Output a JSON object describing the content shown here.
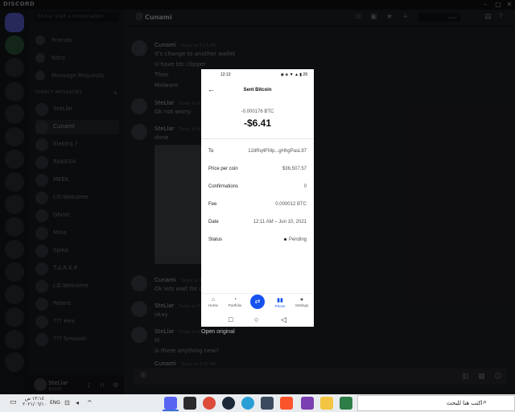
{
  "app": {
    "brand": "DISCORD"
  },
  "window": {
    "minimize": "–",
    "maximize": "□",
    "close": "✕"
  },
  "sidebar": {
    "search_placeholder": "Find or start a conversation",
    "nav": [
      "Friends",
      "Nitro",
      "Message Requests"
    ],
    "dm_header": "DIRECT MESSAGES",
    "dms": [
      "SteLlar",
      "Cunami",
      "Elektra ?",
      "RAKESH",
      "MEEK",
      "I.O.Welcome",
      "Ghost",
      "Mina",
      "Spike",
      "T.A.R.E.P",
      "I.O.Welcome",
      "Peters",
      "??? Hex",
      "??? Smaash"
    ]
  },
  "user_panel": {
    "name": "SteLlar",
    "tag": "#6068"
  },
  "chat": {
    "channel": "Cunami",
    "search_placeholder": "بحث",
    "messages": [
      {
        "author": "Cunami",
        "time": "Today at 8:12 AM",
        "lines": [
          "it's change to another wallet",
          "U have btc clipper",
          "Then",
          "Malware"
        ]
      },
      {
        "author": "SteLlar",
        "time": "Today at 8:13 AM",
        "lines": [
          "Ok not worry"
        ]
      },
      {
        "author": "SteLlar",
        "time": "Today at 8:14 AM",
        "lines": [
          "done"
        ]
      },
      {
        "author": "Cunami",
        "time": "Today at 8:17 AM",
        "lines": [
          "Ok lets wait for confirm"
        ]
      },
      {
        "author": "SteLlar",
        "time": "Today at 8:17 AM",
        "lines": [
          "okay"
        ]
      },
      {
        "author": "SteLlar",
        "time": "Today at 8:18 AM",
        "lines": [
          "hi",
          "is there anything new?"
        ]
      },
      {
        "author": "Cunami",
        "time": "Today at 8:20 AM",
        "lines": []
      }
    ]
  },
  "phone": {
    "status_time": "12:13",
    "status_icons": "◉ ◈ ▼ ▲ ▮ 28",
    "back": "←",
    "title": "Sent Bitcoin",
    "btc_amount": "-0.000176 BTC",
    "usd_amount": "-$6.41",
    "rows": [
      {
        "label": "To",
        "value": "12dRq4FMp...gHhgPasL97"
      },
      {
        "label": "Price per coin",
        "value": "$36,507.57"
      },
      {
        "label": "Confirmations",
        "value": "0"
      },
      {
        "label": "Fee",
        "value": "0.000012 BTC"
      },
      {
        "label": "Date",
        "value": "12:11 AM – Jun 10, 2021"
      },
      {
        "label": "Status",
        "value": "Pending"
      }
    ],
    "nav": [
      {
        "icon": "⌂",
        "label": "Home"
      },
      {
        "icon": "◔",
        "label": "Portfolio"
      },
      {
        "icon": "⇄",
        "label": ""
      },
      {
        "icon": "▮▮",
        "label": "Prices"
      },
      {
        "icon": "●",
        "label": "Settings"
      }
    ],
    "system_nav": [
      "□",
      "○",
      "◁"
    ]
  },
  "open_original": "Open original",
  "taskbar": {
    "search_text": "اكتب هنا للبحث",
    "clock_time": "١٢:١٤ ص",
    "clock_date": "٢٠٢١/٠٦/١٠",
    "lang": "ENG"
  }
}
